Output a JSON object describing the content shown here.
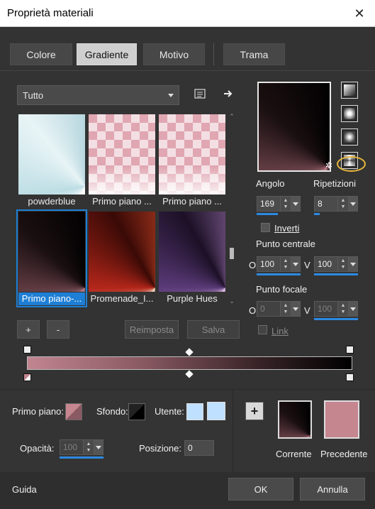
{
  "window": {
    "title": "Proprietà materiali",
    "close_label": "✕"
  },
  "tabs": [
    {
      "label": "Colore"
    },
    {
      "label": "Gradiente"
    },
    {
      "label": "Motivo"
    },
    {
      "label": "Trama"
    }
  ],
  "library": {
    "category": "Tutto",
    "items": [
      {
        "label": "powderblue"
      },
      {
        "label": "Primo piano ..."
      },
      {
        "label": "Primo piano ..."
      },
      {
        "label": "Primo piano-..."
      },
      {
        "label": "Promenade_I..."
      },
      {
        "label": "Purple Hues"
      }
    ],
    "add_label": "+",
    "remove_label": "-",
    "reset_label": "Reimposta",
    "save_label": "Salva"
  },
  "gradient_settings": {
    "angle_label": "Angolo",
    "angle_value": "169",
    "repeats_label": "Ripetizioni",
    "repeats_value": "8",
    "invert_label": "Inverti",
    "center_label": "Punto centrale",
    "center_h_label": "O",
    "center_h_value": "100",
    "center_v_label": "V",
    "center_v_value": "100",
    "focal_label": "Punto focale",
    "focal_h_label": "O",
    "focal_h_value": "0",
    "focal_v_label": "V",
    "focal_v_value": "100",
    "link_label": "Link"
  },
  "editor": {
    "foreground_label": "Primo piano:",
    "background_label": "Sfondo:",
    "user_label": "Utente:",
    "opacity_label": "Opacità:",
    "opacity_value": "100",
    "position_label": "Posizione:",
    "position_value": "0",
    "current_label": "Corrente",
    "previous_label": "Precedente",
    "add_label": "+"
  },
  "footer": {
    "help_label": "Guida",
    "ok_label": "OK",
    "cancel_label": "Annulla"
  },
  "colors": {
    "accent": "#1e7fd4",
    "highlight": "#e8b73a",
    "previous_color": "#c58690",
    "user_color": "#bfe0ff"
  }
}
